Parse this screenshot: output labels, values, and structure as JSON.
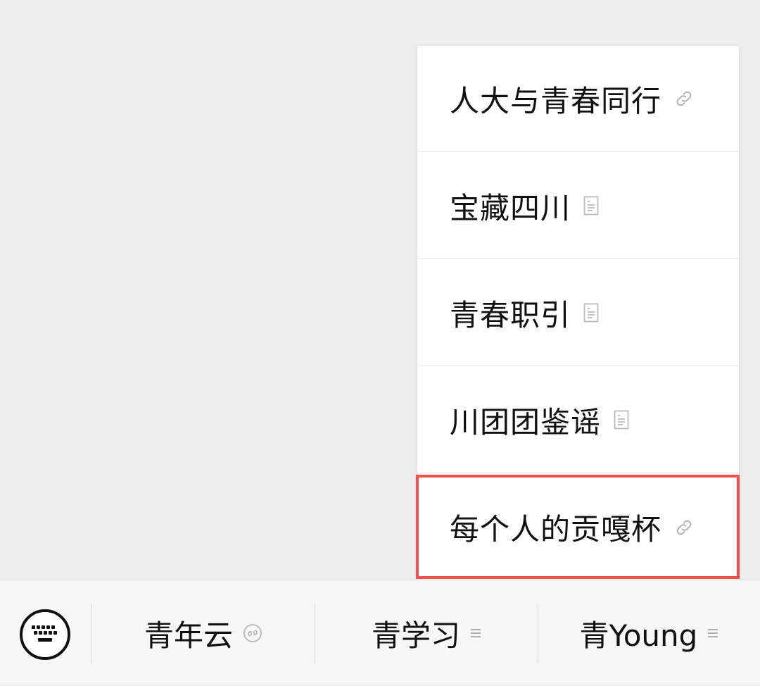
{
  "popup_menu": {
    "items": [
      {
        "label": "人大与青春同行",
        "icon": "link-icon"
      },
      {
        "label": "宝藏四川",
        "icon": "article-icon"
      },
      {
        "label": "青春职引",
        "icon": "article-icon"
      },
      {
        "label": "川团团鉴谣",
        "icon": "article-icon"
      },
      {
        "label": "每个人的贡嘎杯",
        "icon": "link-icon"
      }
    ],
    "highlighted_index": 4,
    "highlight_color": "#ef5050"
  },
  "bottom_bar": {
    "keyboard_icon": "keyboard-icon",
    "menus": [
      {
        "label": "青年云",
        "icon": "mini-program-icon"
      },
      {
        "label": "青学习",
        "icon": "submenu-icon"
      },
      {
        "label": "青Young",
        "icon": "submenu-icon"
      }
    ]
  }
}
